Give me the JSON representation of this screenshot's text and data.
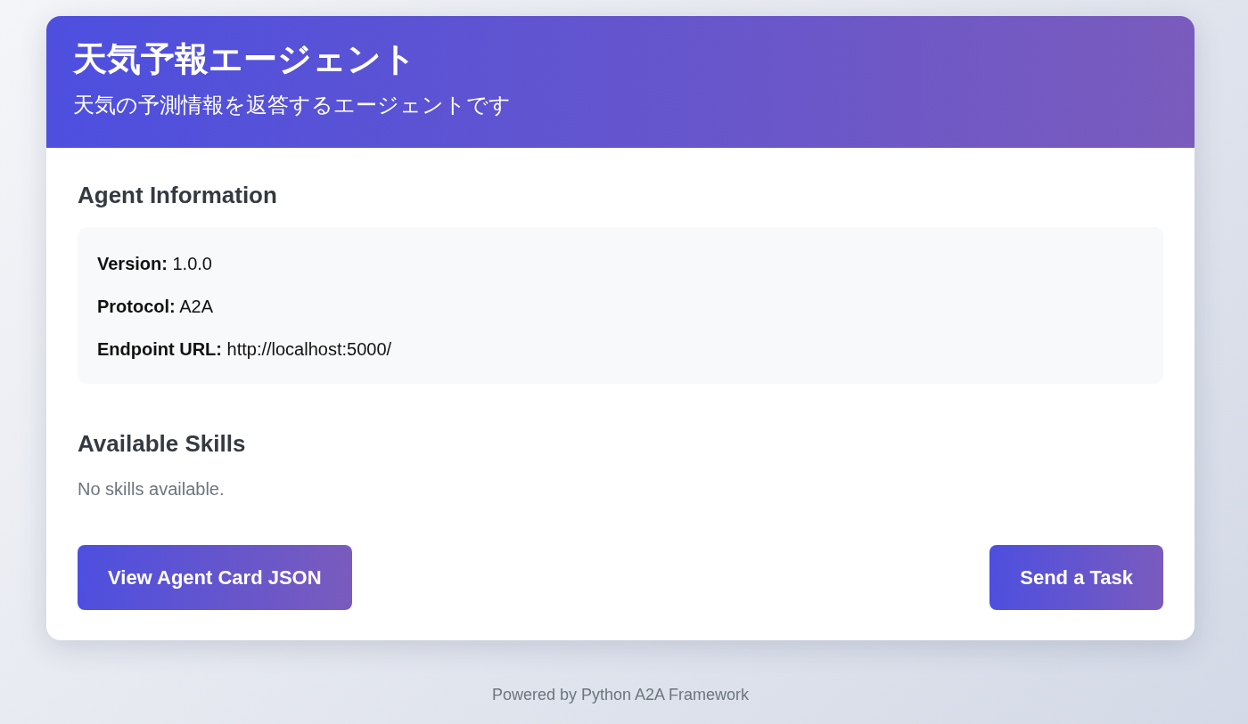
{
  "header": {
    "title": "天気予報エージェント",
    "subtitle": "天気の予測情報を返答するエージェントです"
  },
  "agent_info": {
    "heading": "Agent Information",
    "fields": [
      {
        "label": "Version:",
        "value": "1.0.0"
      },
      {
        "label": "Protocol:",
        "value": "A2A"
      },
      {
        "label": "Endpoint URL:",
        "value": "http://localhost:5000/"
      }
    ]
  },
  "skills": {
    "heading": "Available Skills",
    "empty_text": "No skills available."
  },
  "buttons": [
    {
      "label": "View Agent Card JSON"
    },
    {
      "label": "Send a Task"
    }
  ],
  "footer": "Powered by Python A2A Framework"
}
